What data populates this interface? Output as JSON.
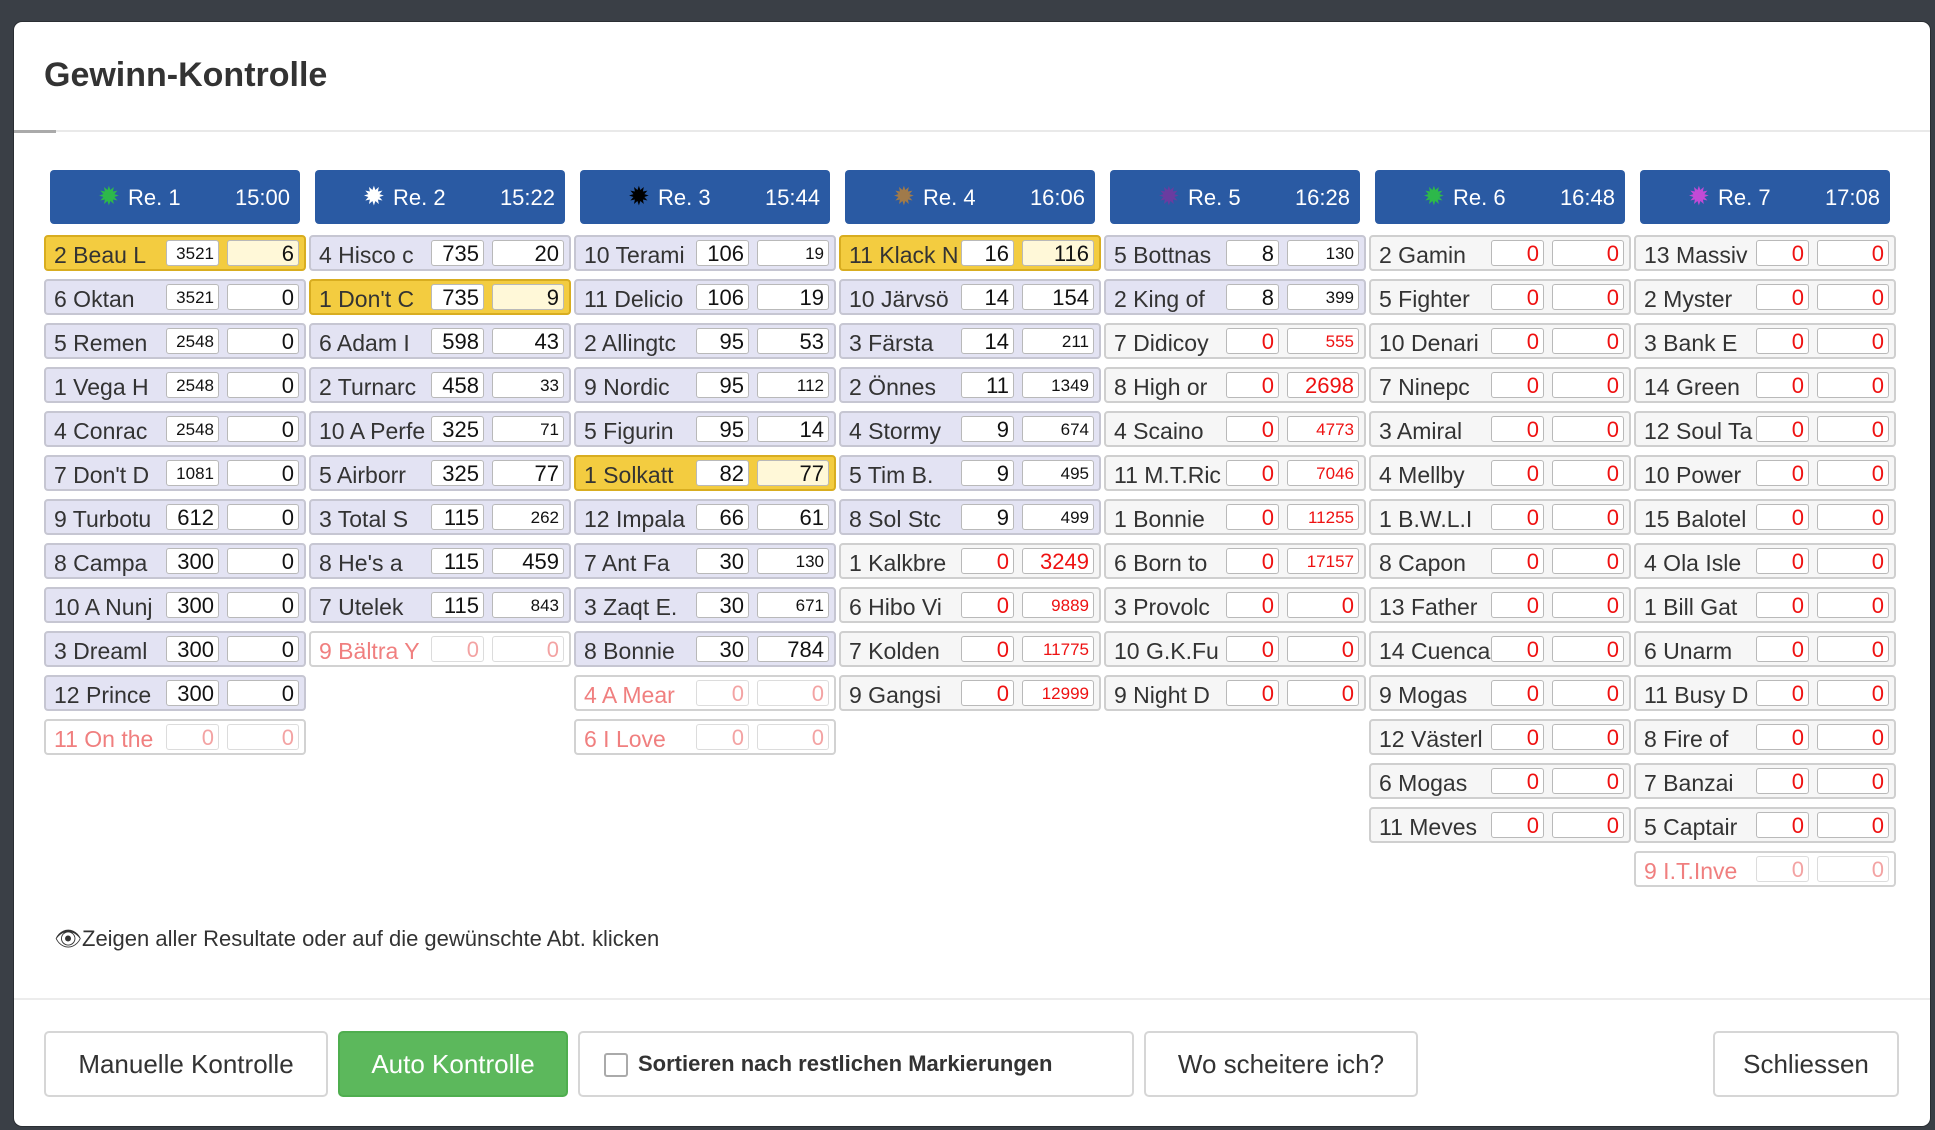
{
  "modal": {
    "title": "Gewinn-Kontrolle",
    "hint": "Zeigen aller Resultate oder auf die gewünschte Abt. klicken",
    "buttons": {
      "manual": "Manuelle Kontrolle",
      "auto": "Auto Kontrolle",
      "sort_label": "Sortieren nach restlichen Markierungen",
      "fail": "Wo scheitere ich?",
      "close": "Schliessen"
    }
  },
  "colors": {
    "header": "#2a5aa3",
    "highlight": "#f3cc40",
    "row": "#e3e3f3",
    "green_button": "#5cb85c",
    "red_value": "#e11"
  },
  "races": [
    {
      "label": "Re. 1",
      "time": "15:00",
      "star_color": "#2db84a",
      "rows": [
        {
          "name": "2 Beau L",
          "a": "3521",
          "b": "6",
          "s": "hl",
          "as": 1
        },
        {
          "name": "6 Oktan",
          "a": "3521",
          "b": "0",
          "as": 1
        },
        {
          "name": "5 Remen",
          "a": "2548",
          "b": "0",
          "as": 1
        },
        {
          "name": "1 Vega H",
          "a": "2548",
          "b": "0",
          "as": 1
        },
        {
          "name": "4 Conrac",
          "a": "2548",
          "b": "0",
          "as": 1
        },
        {
          "name": "7 Don't D",
          "a": "1081",
          "b": "0",
          "as": 1
        },
        {
          "name": "9 Turbotu",
          "a": "612",
          "b": "0"
        },
        {
          "name": "8 Campa",
          "a": "300",
          "b": "0"
        },
        {
          "name": "10 A Nunj",
          "a": "300",
          "b": "0"
        },
        {
          "name": "3 Dreaml",
          "a": "300",
          "b": "0"
        },
        {
          "name": "12 Prince",
          "a": "300",
          "b": "0"
        },
        {
          "name": "11 On the",
          "a": "0",
          "b": "0",
          "s": "out"
        }
      ]
    },
    {
      "label": "Re. 2",
      "time": "15:22",
      "star_color": "#ffffff",
      "rows": [
        {
          "name": "4 Hisco c",
          "a": "735",
          "b": "20"
        },
        {
          "name": "1 Don't C",
          "a": "735",
          "b": "9",
          "s": "hl"
        },
        {
          "name": "6 Adam I",
          "a": "598",
          "b": "43"
        },
        {
          "name": "2 Turnarc",
          "a": "458",
          "b": "33",
          "bs": 1
        },
        {
          "name": "10 A Perfe",
          "a": "325",
          "b": "71",
          "bs": 1
        },
        {
          "name": "5 Airborr",
          "a": "325",
          "b": "77"
        },
        {
          "name": "3 Total S",
          "a": "115",
          "b": "262",
          "bs": 1
        },
        {
          "name": "8 He's a",
          "a": "115",
          "b": "459"
        },
        {
          "name": "7 Utelek",
          "a": "115",
          "b": "843",
          "bs": 1
        },
        {
          "name": "9 Bältra Y",
          "a": "0",
          "b": "0",
          "s": "out"
        }
      ]
    },
    {
      "label": "Re. 3",
      "time": "15:44",
      "star_color": "#000000",
      "rows": [
        {
          "name": "10 Terami",
          "a": "106",
          "b": "19",
          "bs": 1
        },
        {
          "name": "11 Delicio",
          "a": "106",
          "b": "19"
        },
        {
          "name": "2 Allingtc",
          "a": "95",
          "b": "53"
        },
        {
          "name": "9 Nordic",
          "a": "95",
          "b": "112",
          "bs": 1
        },
        {
          "name": "5 Figurin",
          "a": "95",
          "b": "14"
        },
        {
          "name": "1 Solkatt",
          "a": "82",
          "b": "77",
          "s": "hl"
        },
        {
          "name": "12 Impala",
          "a": "66",
          "b": "61"
        },
        {
          "name": "7 Ant Fa",
          "a": "30",
          "b": "130",
          "bs": 1
        },
        {
          "name": "3 Zaqt E.",
          "a": "30",
          "b": "671",
          "bs": 1
        },
        {
          "name": "8 Bonnie",
          "a": "30",
          "b": "784"
        },
        {
          "name": "4 A Mear",
          "a": "0",
          "b": "0",
          "s": "out"
        },
        {
          "name": "6 I Love",
          "a": "0",
          "b": "0",
          "s": "out"
        }
      ]
    },
    {
      "label": "Re. 4",
      "time": "16:06",
      "star_color": "#a07a4a",
      "rows": [
        {
          "name": "11 Klack N",
          "a": "16",
          "b": "116",
          "s": "hl"
        },
        {
          "name": "10 Järvsö",
          "a": "14",
          "b": "154"
        },
        {
          "name": "3 Färsta",
          "a": "14",
          "b": "211",
          "bs": 1
        },
        {
          "name": "2 Önnes",
          "a": "11",
          "b": "1349",
          "bs": 1
        },
        {
          "name": "4 Stormy",
          "a": "9",
          "b": "674",
          "bs": 1
        },
        {
          "name": "5 Tim B.",
          "a": "9",
          "b": "495",
          "bs": 1
        },
        {
          "name": "8 Sol Stc",
          "a": "9",
          "b": "499",
          "bs": 1
        },
        {
          "name": "1 Kalkbre",
          "a": "0",
          "b": "3249",
          "s": "gray",
          "ar": 1,
          "br": 1
        },
        {
          "name": "6 Hibo Vi",
          "a": "0",
          "b": "9889",
          "s": "gray",
          "ar": 1,
          "br": 1,
          "bs": 1
        },
        {
          "name": "7 Kolden",
          "a": "0",
          "b": "11775",
          "s": "gray",
          "ar": 1,
          "br": 1,
          "bs": 1
        },
        {
          "name": "9 Gangsi",
          "a": "0",
          "b": "12999",
          "s": "gray",
          "ar": 1,
          "br": 1,
          "bs": 1
        }
      ]
    },
    {
      "label": "Re. 5",
      "time": "16:28",
      "star_color": "#6a3ca0",
      "rows": [
        {
          "name": "5 Bottnas",
          "a": "8",
          "b": "130",
          "bs": 1
        },
        {
          "name": "2 King of",
          "a": "8",
          "b": "399",
          "bs": 1
        },
        {
          "name": "7 Didicoy",
          "a": "0",
          "b": "555",
          "s": "gray",
          "ar": 1,
          "br": 1,
          "bs": 1
        },
        {
          "name": "8 High or",
          "a": "0",
          "b": "2698",
          "s": "gray",
          "ar": 1,
          "br": 1
        },
        {
          "name": "4 Scaino",
          "a": "0",
          "b": "4773",
          "s": "gray",
          "ar": 1,
          "br": 1,
          "bs": 1
        },
        {
          "name": "11 M.T.Ric",
          "a": "0",
          "b": "7046",
          "s": "gray",
          "ar": 1,
          "br": 1,
          "bs": 1
        },
        {
          "name": "1 Bonnie",
          "a": "0",
          "b": "11255",
          "s": "gray",
          "ar": 1,
          "br": 1,
          "bs": 1
        },
        {
          "name": "6 Born to",
          "a": "0",
          "b": "17157",
          "s": "gray",
          "ar": 1,
          "br": 1,
          "bs": 1
        },
        {
          "name": "3 Provolc",
          "a": "0",
          "b": "0",
          "s": "gray",
          "ar": 1,
          "br": 1
        },
        {
          "name": "10 G.K.Fu",
          "a": "0",
          "b": "0",
          "s": "gray",
          "ar": 1,
          "br": 1
        },
        {
          "name": "9 Night D",
          "a": "0",
          "b": "0",
          "s": "gray",
          "ar": 1,
          "br": 1
        }
      ]
    },
    {
      "label": "Re. 6",
      "time": "16:48",
      "star_color": "#2db84a",
      "rows": [
        {
          "name": "2 Gamin",
          "a": "0",
          "b": "0",
          "s": "gray",
          "ar": 1,
          "br": 1
        },
        {
          "name": "5 Fighter",
          "a": "0",
          "b": "0",
          "s": "gray",
          "ar": 1,
          "br": 1
        },
        {
          "name": "10 Denari",
          "a": "0",
          "b": "0",
          "s": "gray",
          "ar": 1,
          "br": 1
        },
        {
          "name": "7 Ninepc",
          "a": "0",
          "b": "0",
          "s": "gray",
          "ar": 1,
          "br": 1
        },
        {
          "name": "3 Amiral",
          "a": "0",
          "b": "0",
          "s": "gray",
          "ar": 1,
          "br": 1
        },
        {
          "name": "4 Mellby",
          "a": "0",
          "b": "0",
          "s": "gray",
          "ar": 1,
          "br": 1
        },
        {
          "name": "1 B.W.L.I",
          "a": "0",
          "b": "0",
          "s": "gray",
          "ar": 1,
          "br": 1
        },
        {
          "name": "8 Capon",
          "a": "0",
          "b": "0",
          "s": "gray",
          "ar": 1,
          "br": 1
        },
        {
          "name": "13 Father",
          "a": "0",
          "b": "0",
          "s": "gray",
          "ar": 1,
          "br": 1
        },
        {
          "name": "14 Cuenca",
          "a": "0",
          "b": "0",
          "s": "gray",
          "ar": 1,
          "br": 1
        },
        {
          "name": "9 Mogas",
          "a": "0",
          "b": "0",
          "s": "gray",
          "ar": 1,
          "br": 1
        },
        {
          "name": "12 Västerl",
          "a": "0",
          "b": "0",
          "s": "gray",
          "ar": 1,
          "br": 1
        },
        {
          "name": "6 Mogas",
          "a": "0",
          "b": "0",
          "s": "gray",
          "ar": 1,
          "br": 1
        },
        {
          "name": "11 Meves",
          "a": "0",
          "b": "0",
          "s": "gray",
          "ar": 1,
          "br": 1
        }
      ]
    },
    {
      "label": "Re. 7",
      "time": "17:08",
      "star_color": "#c24ad6",
      "rows": [
        {
          "name": "13 Massiv",
          "a": "0",
          "b": "0",
          "s": "gray",
          "ar": 1,
          "br": 1
        },
        {
          "name": "2 Myster",
          "a": "0",
          "b": "0",
          "s": "gray",
          "ar": 1,
          "br": 1
        },
        {
          "name": "3 Bank E",
          "a": "0",
          "b": "0",
          "s": "gray",
          "ar": 1,
          "br": 1
        },
        {
          "name": "14 Green",
          "a": "0",
          "b": "0",
          "s": "gray",
          "ar": 1,
          "br": 1
        },
        {
          "name": "12 Soul Ta",
          "a": "0",
          "b": "0",
          "s": "gray",
          "ar": 1,
          "br": 1
        },
        {
          "name": "10 Power",
          "a": "0",
          "b": "0",
          "s": "gray",
          "ar": 1,
          "br": 1
        },
        {
          "name": "15 Balotel",
          "a": "0",
          "b": "0",
          "s": "gray",
          "ar": 1,
          "br": 1
        },
        {
          "name": "4 Ola Isle",
          "a": "0",
          "b": "0",
          "s": "gray",
          "ar": 1,
          "br": 1
        },
        {
          "name": "1 Bill Gat",
          "a": "0",
          "b": "0",
          "s": "gray",
          "ar": 1,
          "br": 1
        },
        {
          "name": "6 Unarm",
          "a": "0",
          "b": "0",
          "s": "gray",
          "ar": 1,
          "br": 1
        },
        {
          "name": "11 Busy D",
          "a": "0",
          "b": "0",
          "s": "gray",
          "ar": 1,
          "br": 1
        },
        {
          "name": "8 Fire of",
          "a": "0",
          "b": "0",
          "s": "gray",
          "ar": 1,
          "br": 1
        },
        {
          "name": "7 Banzai",
          "a": "0",
          "b": "0",
          "s": "gray",
          "ar": 1,
          "br": 1
        },
        {
          "name": "5 Captair",
          "a": "0",
          "b": "0",
          "s": "gray",
          "ar": 1,
          "br": 1
        },
        {
          "name": "9 I.T.Inve",
          "a": "0",
          "b": "0",
          "s": "out"
        }
      ]
    }
  ]
}
